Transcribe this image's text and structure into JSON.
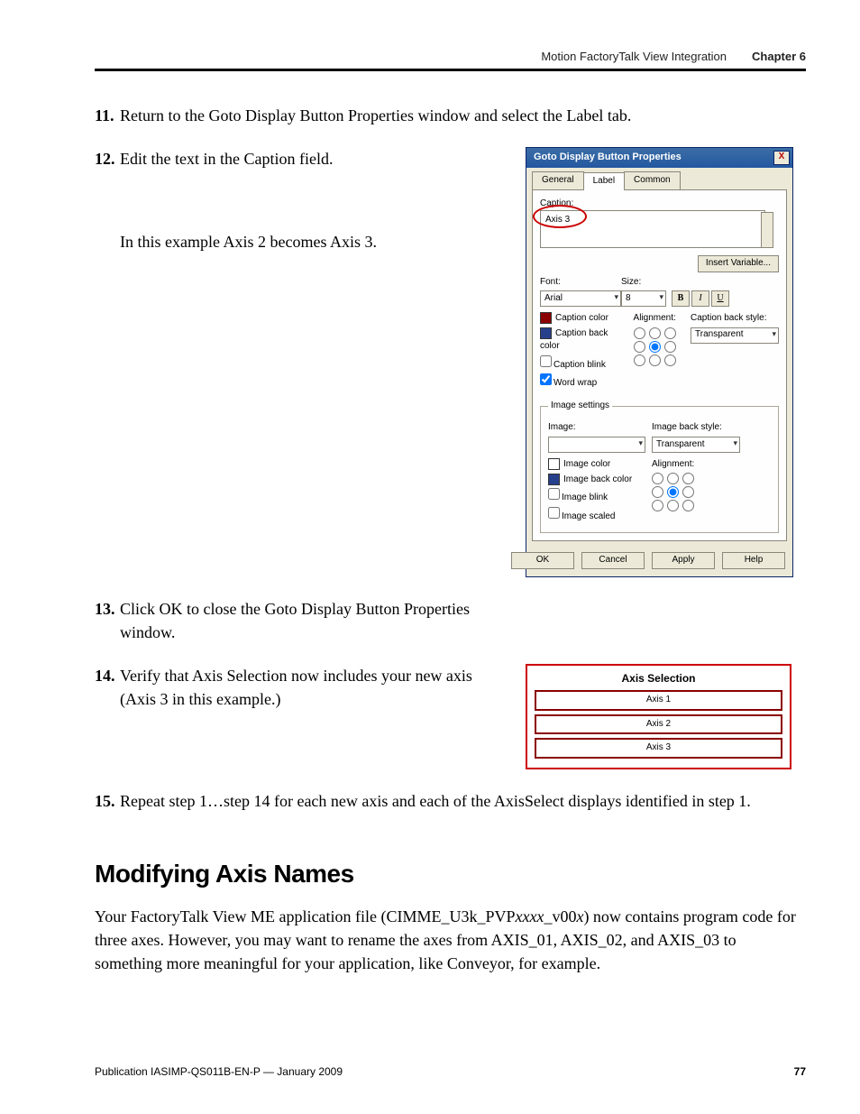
{
  "header": {
    "doc_section": "Motion FactoryTalk View Integration",
    "chapter": "Chapter 6"
  },
  "steps": {
    "s11": {
      "num": "11.",
      "text": "Return to the Goto Display Button Properties window and select the Label tab."
    },
    "s12": {
      "num": "12.",
      "text": "Edit the text in the Caption field.",
      "note": "In this example Axis 2 becomes Axis 3."
    },
    "s13": {
      "num": "13.",
      "text": "Click OK to close the Goto Display Button Properties window."
    },
    "s14": {
      "num": "14.",
      "text": "Verify that Axis Selection now includes your new axis (Axis 3 in this example.)"
    },
    "s15": {
      "num": "15.",
      "text": "Repeat step 1…step 14 for each new axis and each of the AxisSelect displays identified in step 1."
    }
  },
  "dialog": {
    "title": "Goto Display Button Properties",
    "tabs": {
      "general": "General",
      "label": "Label",
      "common": "Common"
    },
    "caption_label": "Caption:",
    "caption_value": "Axis 3",
    "insert_var": "Insert Variable...",
    "font_label": "Font:",
    "font_value": "Arial",
    "size_label": "Size:",
    "size_value": "8",
    "bold": "B",
    "italic": "I",
    "underline": "U",
    "caption_color": "Caption color",
    "caption_back_color": "Caption back color",
    "caption_blink": "Caption blink",
    "word_wrap": "Word wrap",
    "alignment": "Alignment:",
    "caption_back_style": "Caption back style:",
    "back_style_value": "Transparent",
    "image_settings": "Image settings",
    "image_label": "Image:",
    "image_back_style": "Image back style:",
    "image_back_style_value": "Transparent",
    "image_color": "Image color",
    "image_back_color": "Image back color",
    "image_blink": "Image blink",
    "image_scaled": "Image scaled",
    "ok": "OK",
    "cancel": "Cancel",
    "apply": "Apply",
    "help": "Help"
  },
  "axis_panel": {
    "title": "Axis Selection",
    "axis1": "Axis 1",
    "axis2": "Axis 2",
    "axis3": "Axis 3"
  },
  "section": {
    "heading": "Modifying Axis Names",
    "para_pre": "Your FactoryTalk View ME application file (CIMME_U3k_PVP",
    "para_mid1": "xxxx",
    "para_mid2": "_v00",
    "para_mid3": "x",
    "para_post": ") now contains program code for three axes. However, you may want to rename the axes from AXIS_01, AXIS_02, and AXIS_03 to something more meaningful for your application, like Conveyor, for example."
  },
  "footer": {
    "pub": "Publication IASIMP-QS011B-EN-P — January 2009",
    "page": "77"
  }
}
